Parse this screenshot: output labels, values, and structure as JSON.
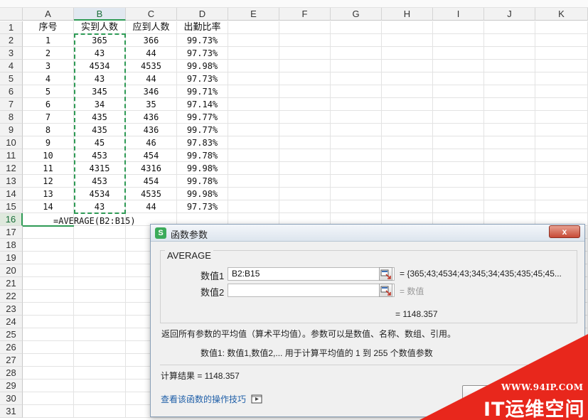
{
  "columns": [
    "A",
    "B",
    "C",
    "D",
    "E",
    "F",
    "G",
    "H",
    "I",
    "J",
    "K"
  ],
  "row_numbers": [
    "1",
    "2",
    "3",
    "4",
    "5",
    "6",
    "7",
    "8",
    "9",
    "10",
    "11",
    "12",
    "13",
    "14",
    "15",
    "16",
    "17",
    "18",
    "19",
    "20",
    "21",
    "22",
    "23",
    "24",
    "25",
    "26",
    "27",
    "28",
    "29",
    "30",
    "31"
  ],
  "headers": [
    "序号",
    "实到人数",
    "应到人数",
    "出勤比率"
  ],
  "rows": [
    [
      "1",
      "365",
      "366",
      "99.73%"
    ],
    [
      "2",
      "43",
      "44",
      "97.73%"
    ],
    [
      "3",
      "4534",
      "4535",
      "99.98%"
    ],
    [
      "4",
      "43",
      "44",
      "97.73%"
    ],
    [
      "5",
      "345",
      "346",
      "99.71%"
    ],
    [
      "6",
      "34",
      "35",
      "97.14%"
    ],
    [
      "7",
      "435",
      "436",
      "99.77%"
    ],
    [
      "8",
      "435",
      "436",
      "99.77%"
    ],
    [
      "9",
      "45",
      "46",
      "97.83%"
    ],
    [
      "10",
      "453",
      "454",
      "99.78%"
    ],
    [
      "11",
      "4315",
      "4316",
      "99.98%"
    ],
    [
      "12",
      "453",
      "454",
      "99.78%"
    ],
    [
      "13",
      "4534",
      "4535",
      "99.98%"
    ],
    [
      "14",
      "43",
      "44",
      "97.73%"
    ]
  ],
  "formula": "=AVERAGE(B2:B15)",
  "dialog": {
    "title": "函数参数",
    "app_icon": "S",
    "close_label": "x",
    "function_name": "AVERAGE",
    "arg1_label": "数值1",
    "arg1_value": "B2:B15",
    "arg1_result": "= {365;43;4534;43;345;34;435;435;45;45...",
    "arg2_label": "数值2",
    "arg2_result": "= 数值",
    "total_result": "= 1148.357",
    "description": "返回所有参数的平均值（算术平均值）。参数可以是数值、名称、数组、引用。",
    "arg_help": "数值1:   数值1,数值2,... 用于计算平均值的 1 到 255 个数值参数",
    "calc_result": "计算结果 = 1148.357",
    "help_link": "查看该函数的操作技巧"
  },
  "watermark": {
    "url": "WWW.94IP.COM",
    "text": "IT运维空间"
  },
  "colors": {
    "accent": "#2e9a55",
    "watermark": "#e8271c",
    "link": "#1f5fa8"
  }
}
